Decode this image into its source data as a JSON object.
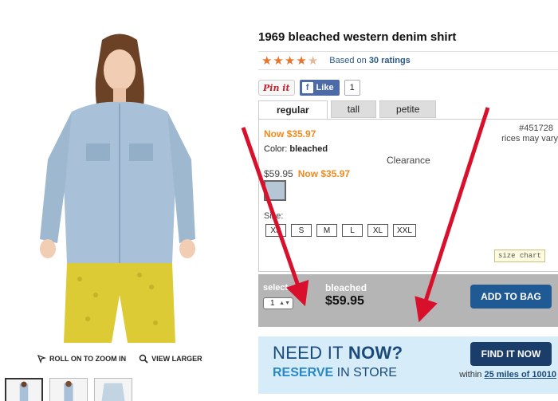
{
  "product": {
    "title": "1969 bleached western denim shirt",
    "rating_text": "Based on",
    "rating_count": "30 ratings",
    "stars": 4.5,
    "social": {
      "pin_label": "Pin it",
      "like_label": "Like",
      "like_count": "1"
    },
    "tabs": [
      "regular",
      "tall",
      "petite"
    ],
    "now_price_label": "Now $35.97",
    "sku": "#451728",
    "price_vary": "rices may vary",
    "color_label": "Color:",
    "color_value": "bleached",
    "clearance": "Clearance",
    "was_price": "$59.95",
    "now_price": "Now $35.97",
    "size_label": "Size:",
    "sizes": [
      "XS",
      "S",
      "M",
      "L",
      "XL",
      "XXL"
    ],
    "size_chart": "size chart"
  },
  "bag": {
    "select_label": "select",
    "qty": "1",
    "color": "bleached",
    "price": "$59.95",
    "add_label": "ADD TO BAG"
  },
  "store": {
    "need_prefix": "NEED IT",
    "need_bold": "NOW?",
    "reserve_bold": "RESERVE",
    "reserve_rest": "IN STORE",
    "find_label": "FIND IT NOW",
    "within_label": "within",
    "within_link": "25 miles of 10010"
  },
  "gallery": {
    "zoom_label": "ROLL ON TO ZOOM IN",
    "larger_label": "VIEW LARGER"
  },
  "colors": {
    "accent_orange": "#f08a1e",
    "brand_blue": "#1f5a94",
    "arrow_red": "#d8102c"
  }
}
